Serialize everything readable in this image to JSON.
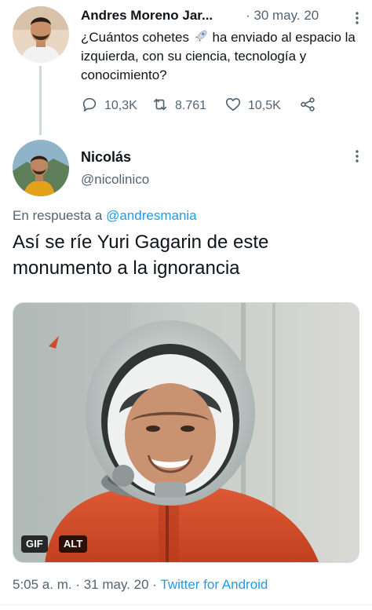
{
  "parent_tweet": {
    "author_name": "Andres Moreno Jar...",
    "date": "· 30 may. 20",
    "text_before_emoji": "¿Cuántos cohetes",
    "emoji": "🚀",
    "text_after_emoji": " ha enviado al espacio la izquierda, con su ciencia, tecnología y conocimiento?",
    "replies": "10,3K",
    "retweets": "8.761",
    "likes": "10,5K"
  },
  "reply_tweet": {
    "author_name": "Nicolás",
    "handle": "@nicolinico",
    "reply_prefix": "En respuesta a",
    "reply_mention": "@andresmania",
    "text": "Así se ríe Yuri Gagarin de este monumento a la ignorancia",
    "media": {
      "gif_badge": "GIF",
      "alt_badge": "ALT"
    },
    "time": "5:05 a. m.",
    "separator1": " · ",
    "date": "31 may. 20",
    "separator2": " · ",
    "source": "Twitter for Android"
  },
  "colors": {
    "link": "#1d9bf0",
    "secondary_text": "#536471",
    "primary_text": "#0f1419",
    "thread_line": "#cfd9de"
  },
  "icons": {
    "reply": "reply-icon",
    "retweet": "retweet-icon",
    "like": "heart-icon",
    "share": "share-icon",
    "more": "more-dots-icon"
  }
}
